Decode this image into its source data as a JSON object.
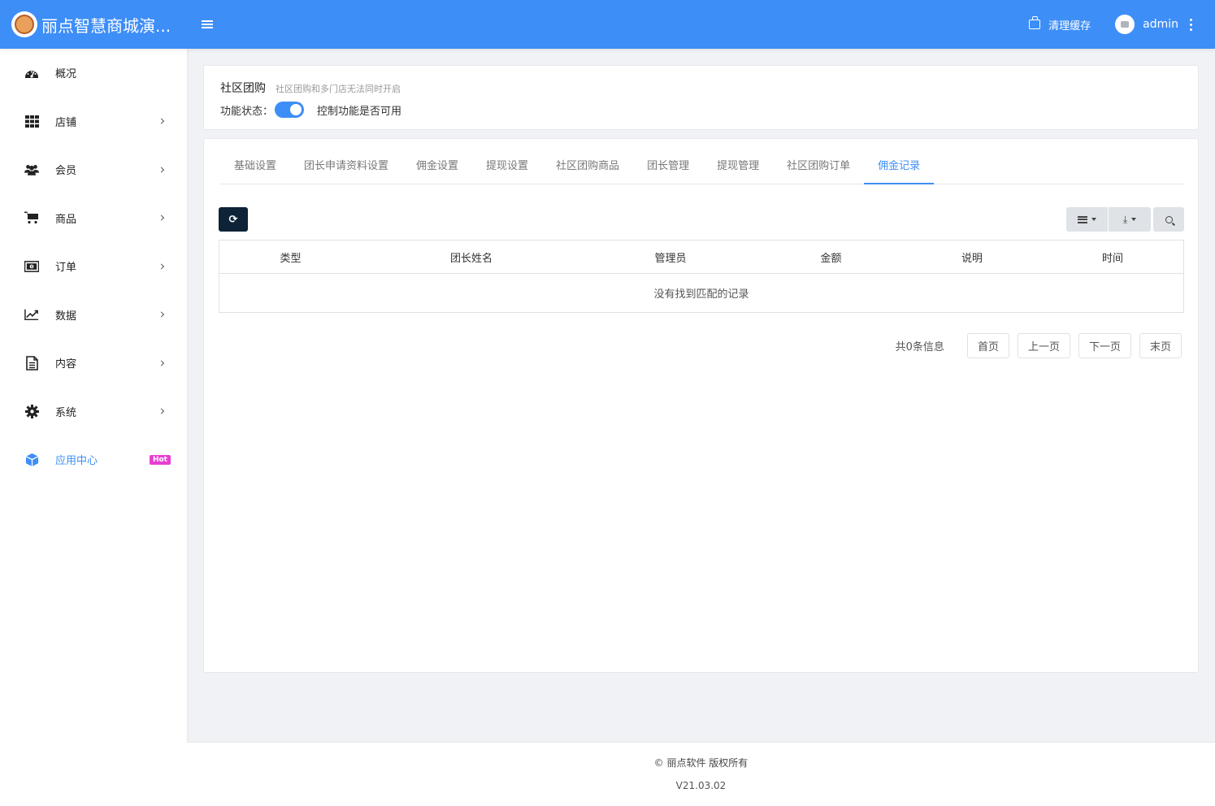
{
  "header": {
    "brand_title": "丽点智慧商城演...",
    "clear_cache": "清理缓存",
    "username": "admin"
  },
  "sidebar": {
    "items": [
      {
        "label": "概况",
        "icon": "dashboard-icon"
      },
      {
        "label": "店铺",
        "icon": "grid-icon"
      },
      {
        "label": "会员",
        "icon": "users-icon"
      },
      {
        "label": "商品",
        "icon": "cart-icon"
      },
      {
        "label": "订单",
        "icon": "money-icon"
      },
      {
        "label": "数据",
        "icon": "chart-line-icon"
      },
      {
        "label": "内容",
        "icon": "document-icon"
      },
      {
        "label": "系统",
        "icon": "gear-icon"
      },
      {
        "label": "应用中心",
        "icon": "cube-icon",
        "badge": "Hot"
      }
    ]
  },
  "feature": {
    "title": "社区团购",
    "subtitle": "社区团购和多门店无法同时开启",
    "status_label": "功能状态：",
    "status_desc": "控制功能是否可用"
  },
  "tabs": [
    "基础设置",
    "团长申请资料设置",
    "佣金设置",
    "提现设置",
    "社区团购商品",
    "团长管理",
    "提现管理",
    "社区团购订单",
    "佣金记录"
  ],
  "active_tab": "佣金记录",
  "table": {
    "columns": [
      "类型",
      "团长姓名",
      "管理员",
      "金额",
      "说明",
      "时间"
    ],
    "empty_text": "没有找到匹配的记录"
  },
  "pagination": {
    "total": "共0条信息",
    "first": "首页",
    "prev": "上一页",
    "next": "下一页",
    "last": "末页"
  },
  "footer": {
    "copyright": "© 丽点软件 版权所有",
    "version": "V21.03.02"
  },
  "colors": {
    "primary": "#3e8ef7",
    "hot_badge": "#e83fd3",
    "refresh_button": "#0e2238"
  }
}
